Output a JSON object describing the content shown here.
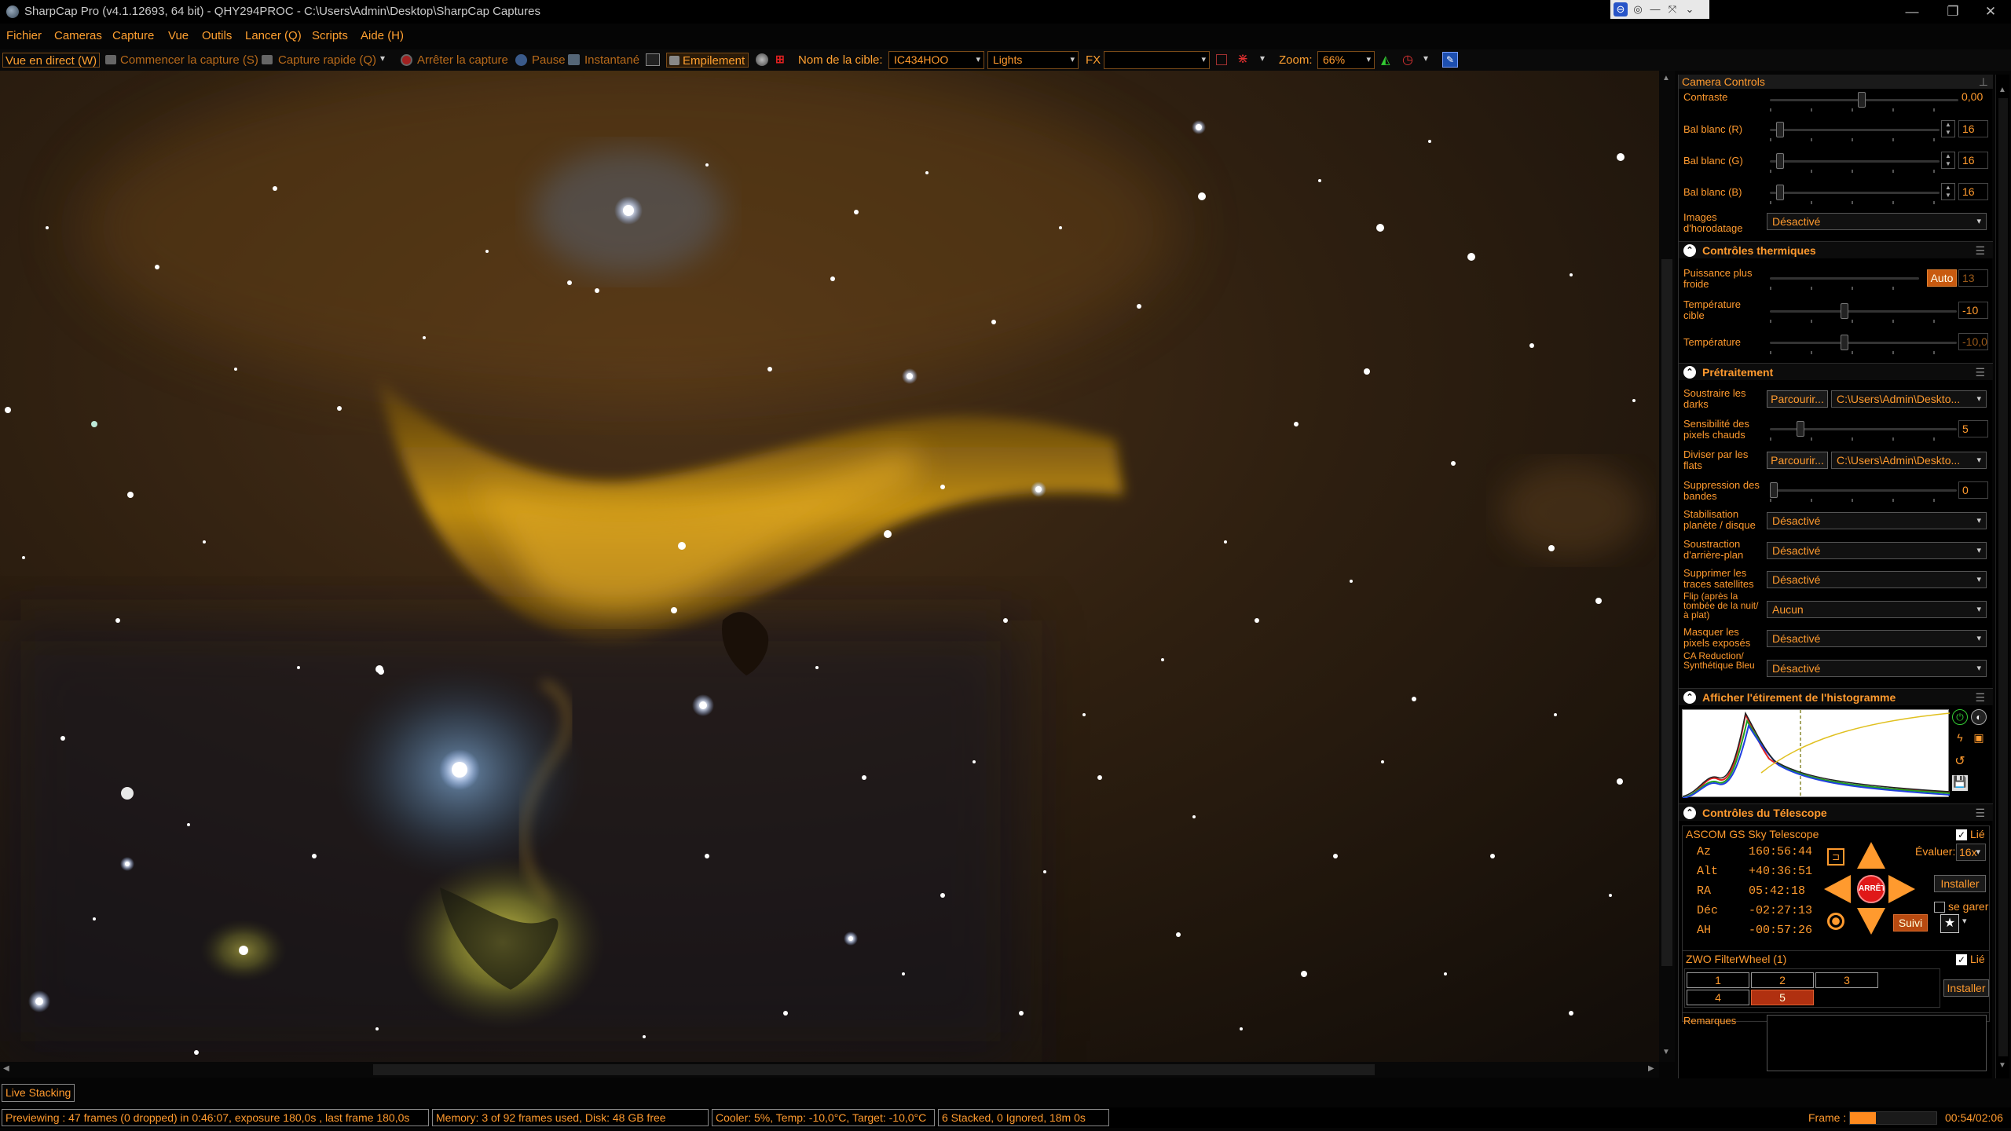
{
  "titlebar": {
    "title": "SharpCap Pro (v4.1.12693, 64 bit) - QHY294PROC - C:\\Users\\Admin\\Desktop\\SharpCap Captures",
    "minimize": "—",
    "maximize": "❐",
    "close": "✕"
  },
  "menubar": {
    "items": [
      "Fichier",
      "Cameras",
      "Capture",
      "Vue",
      "Outils",
      "Lancer (Q)",
      "Scripts",
      "Aide (H)"
    ]
  },
  "toolbar": {
    "live_view": "Vue en direct (W)",
    "start_capture": "Commencer la capture (S)",
    "quick_capture": "Capture rapide (Q)",
    "stop_capture": "Arrêter la capture",
    "pause": "Pause",
    "snapshot": "Instantané",
    "stacking": "Empilement",
    "target_label": "Nom de la cible:",
    "target_value": "IC434HOO",
    "frame_type": "Lights",
    "fx_label": "FX",
    "fx_value": "",
    "zoom_label": "Zoom:",
    "zoom_value": "66%"
  },
  "camera_controls": {
    "title": "Camera Controls",
    "contrast_label": "Contraste",
    "contrast_value": "0,00",
    "wb_r_label": "Bal blanc (R)",
    "wb_r_value": "16",
    "wb_g_label": "Bal blanc (G)",
    "wb_g_value": "16",
    "wb_b_label": "Bal blanc (B)",
    "wb_b_value": "16",
    "timestamp_label": "Images d'horodatage",
    "timestamp_value": "Désactivé"
  },
  "thermal": {
    "title": "Contrôles thermiques",
    "cooler_power_label": "Puissance plus froide",
    "cooler_auto": "Auto",
    "cooler_power_value": "13",
    "target_temp_label": "Température cible",
    "target_temp_value": "-10",
    "temp_label": "Température",
    "temp_value": "-10,0"
  },
  "preprocessing": {
    "title": "Prétraitement",
    "darks_label": "Soustraire les darks",
    "browse": "Parcourir...",
    "darks_path": "C:\\Users\\Admin\\Deskto...",
    "hot_pixel_label": "Sensibilité des pixels chauds",
    "hot_pixel_value": "5",
    "flats_label": "Diviser par les flats",
    "flats_path": "C:\\Users\\Admin\\Deskto...",
    "banding_label": "Suppression des bandes",
    "banding_value": "0",
    "stabilize_label": "Stabilisation planète / disque",
    "stabilize_value": "Désactivé",
    "bg_sub_label": "Soustraction d'arrière-plan",
    "bg_sub_value": "Désactivé",
    "satellite_label": "Supprimer les traces satellites",
    "satellite_value": "Désactivé",
    "flip_label": "Flip (après la tombée de la nuit/à plat)",
    "flip_value": "Aucun",
    "mask_label": "Masquer les pixels exposés",
    "mask_value": "Désactivé",
    "ca_label": "CA Reduction/ Synthétique Bleu",
    "ca_value": "Désactivé"
  },
  "histogram": {
    "title": "Afficher l'étirement de l'histogramme"
  },
  "telescope": {
    "title": "Contrôles du Télescope",
    "device": "ASCOM GS Sky Telescope",
    "linked": "Lié",
    "az_label": "Az",
    "az_value": "160:56:44",
    "alt_label": "Alt",
    "alt_value": "+40:36:51",
    "ra_label": "RA",
    "ra_value": "05:42:18",
    "dec_label": "Déc",
    "dec_value": "-02:27:13",
    "ha_label": "AH",
    "ha_value": "-00:57:26",
    "stop": "ARRÊTE",
    "rate_label": "Évaluer:",
    "rate_value": "16x",
    "setup": "Installer",
    "park": "se garer",
    "track": "Suivi"
  },
  "filterwheel": {
    "device": "ZWO FilterWheel (1)",
    "linked": "Lié",
    "slots": [
      "1",
      "2",
      "3",
      "4",
      "5"
    ],
    "selected_slot": "5",
    "setup": "Installer"
  },
  "notes": {
    "label": "Remarques",
    "value": ""
  },
  "live_stacking_tab": "Live Stacking",
  "status": {
    "preview": "Previewing : 47 frames (0 dropped) in 0:46:07, exposure 180,0s , last frame 180,0s",
    "memory": "Memory: 3 of 92 frames used, Disk: 48 GB free",
    "cooler": "Cooler: 5%, Temp: -10,0°C, Target: -10,0°C",
    "stacked": "6 Stacked, 0 Ignored, 18m 0s",
    "frame_label": "Frame :",
    "frame_progress": 0.3,
    "time": "00:54/02:06"
  },
  "colors": {
    "accent": "#ff9a2e",
    "stop_red": "#e01818",
    "selected_slot": "#b03010"
  }
}
